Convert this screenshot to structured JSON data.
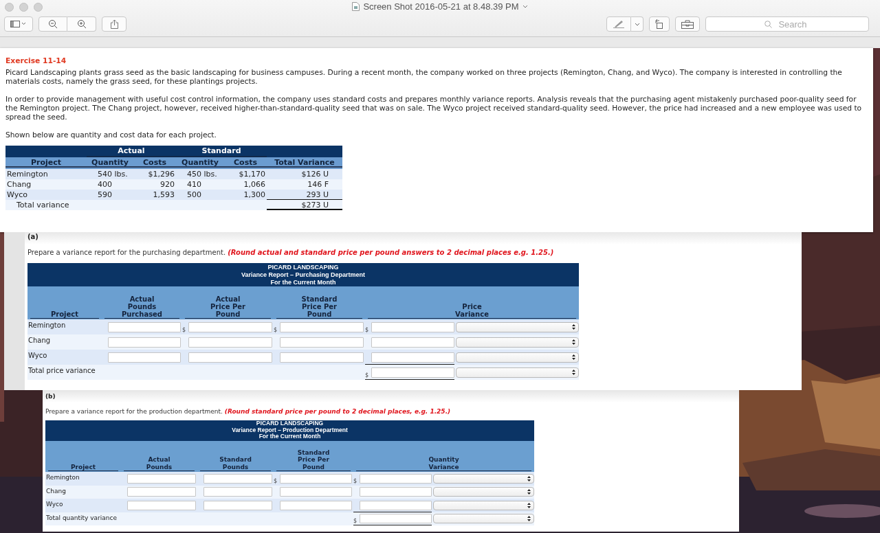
{
  "window": {
    "title": "Screen Shot 2016-05-21 at 8.48.39 PM"
  },
  "toolbar": {
    "search": {
      "placeholder": "Search"
    }
  },
  "exercise": {
    "title": "Exercise 11-14",
    "paragraphs": [
      "Picard Landscaping plants grass seed as the basic landscaping for business campuses. During a recent month, the company worked on three projects (Remington, Chang, and Wyco). The company is interested in controlling the materials costs, namely the grass seed, for these plantings projects.",
      "In order to provide management with useful cost control information, the company uses standard costs and prepares monthly variance reports. Analysis reveals that the purchasing agent mistakenly purchased poor-quality seed for the Remington project. The Chang project, however, received higher-than-standard-quality seed that was on sale. The Wyco project received standard-quality seed. However, the price had increased and a new employee was used to spread the seed.",
      "Shown below are quantity and cost data for each project."
    ],
    "table": {
      "groups": [
        "Actual",
        "Standard"
      ],
      "columns": [
        "Project",
        "Quantity",
        "Costs",
        "Quantity",
        "Costs",
        "Total Variance"
      ],
      "rows": [
        {
          "cells": [
            "Remington",
            "540 lbs.",
            "$1,296",
            "450 lbs.",
            "$1,170",
            "$126 U"
          ]
        },
        {
          "cells": [
            "Chang",
            "400",
            "920",
            "410",
            "1,066",
            "146 F"
          ]
        },
        {
          "cells": [
            "Wyco",
            "590",
            "1,593",
            "500",
            "1,300",
            "293 U"
          ]
        }
      ],
      "total": {
        "label": "Total variance",
        "value": "$273 U"
      }
    }
  },
  "parts": [
    {
      "label": "(a)",
      "instruction": "Prepare a variance report for the purchasing department.",
      "note": "(Round actual and standard price per pound answers to 2 decimal places e.g. 1.25.)",
      "report": {
        "title_lines": [
          "PICARD LANDSCAPING",
          "Variance Report – Purchasing Department",
          "For the Current Month"
        ],
        "columns": [
          {
            "lines": [
              "Project"
            ]
          },
          {
            "lines": [
              "Actual",
              "Pounds",
              "Purchased"
            ]
          },
          {
            "lines": [
              "Actual",
              "Price Per",
              "Pound"
            ]
          },
          {
            "lines": [
              "Standard",
              "Price Per",
              "Pound"
            ]
          },
          {
            "lines": [
              "Price",
              "Variance"
            ]
          }
        ],
        "rows": [
          {
            "project": "Remington",
            "fields": [
              {
                "kind": "input"
              },
              {
                "kind": "input",
                "prefix": "$"
              },
              {
                "kind": "input",
                "prefix": "$"
              },
              {
                "kind": "input",
                "prefix": "$"
              },
              {
                "kind": "select"
              }
            ]
          },
          {
            "project": "Chang",
            "fields": [
              {
                "kind": "input"
              },
              {
                "kind": "input"
              },
              {
                "kind": "input"
              },
              {
                "kind": "input"
              },
              {
                "kind": "select"
              }
            ]
          },
          {
            "project": "Wyco",
            "fields": [
              {
                "kind": "input"
              },
              {
                "kind": "input"
              },
              {
                "kind": "input"
              },
              {
                "kind": "input",
                "underlined": true
              },
              {
                "kind": "select"
              }
            ]
          },
          {
            "project": "Total price variance",
            "fields": [
              {
                "kind": "input",
                "prefix": "$",
                "underlined": true
              },
              {
                "kind": "select"
              }
            ]
          }
        ]
      }
    },
    {
      "label": "(b)",
      "instruction": "Prepare a variance report for the production department.",
      "note": "(Round standard price per pound to 2 decimal places, e.g. 1.25.)",
      "report": {
        "title_lines": [
          "PICARD LANDSCAPING",
          "Variance Report – Production Department",
          "For the Current Month"
        ],
        "columns": [
          {
            "lines": [
              "Project"
            ]
          },
          {
            "lines": [
              "Actual",
              "Pounds"
            ]
          },
          {
            "lines": [
              "Standard",
              "Pounds"
            ]
          },
          {
            "lines": [
              "Standard",
              "Price Per",
              "Pound"
            ]
          },
          {
            "lines": [
              "Quantity",
              "Variance"
            ]
          }
        ],
        "rows": [
          {
            "project": "Remington",
            "fields": [
              {
                "kind": "input"
              },
              {
                "kind": "input"
              },
              {
                "kind": "input",
                "prefix": "$"
              },
              {
                "kind": "input",
                "prefix": "$"
              },
              {
                "kind": "select"
              }
            ]
          },
          {
            "project": "Chang",
            "fields": [
              {
                "kind": "input"
              },
              {
                "kind": "input"
              },
              {
                "kind": "input"
              },
              {
                "kind": "input"
              },
              {
                "kind": "select"
              }
            ]
          },
          {
            "project": "Wyco",
            "fields": [
              {
                "kind": "input"
              },
              {
                "kind": "input"
              },
              {
                "kind": "input"
              },
              {
                "kind": "input",
                "underlined": true
              },
              {
                "kind": "select"
              }
            ]
          },
          {
            "project": "Total quantity variance",
            "fields": [
              {
                "kind": "input",
                "prefix": "$",
                "underlined": true
              },
              {
                "kind": "select"
              }
            ]
          }
        ]
      }
    }
  ]
}
